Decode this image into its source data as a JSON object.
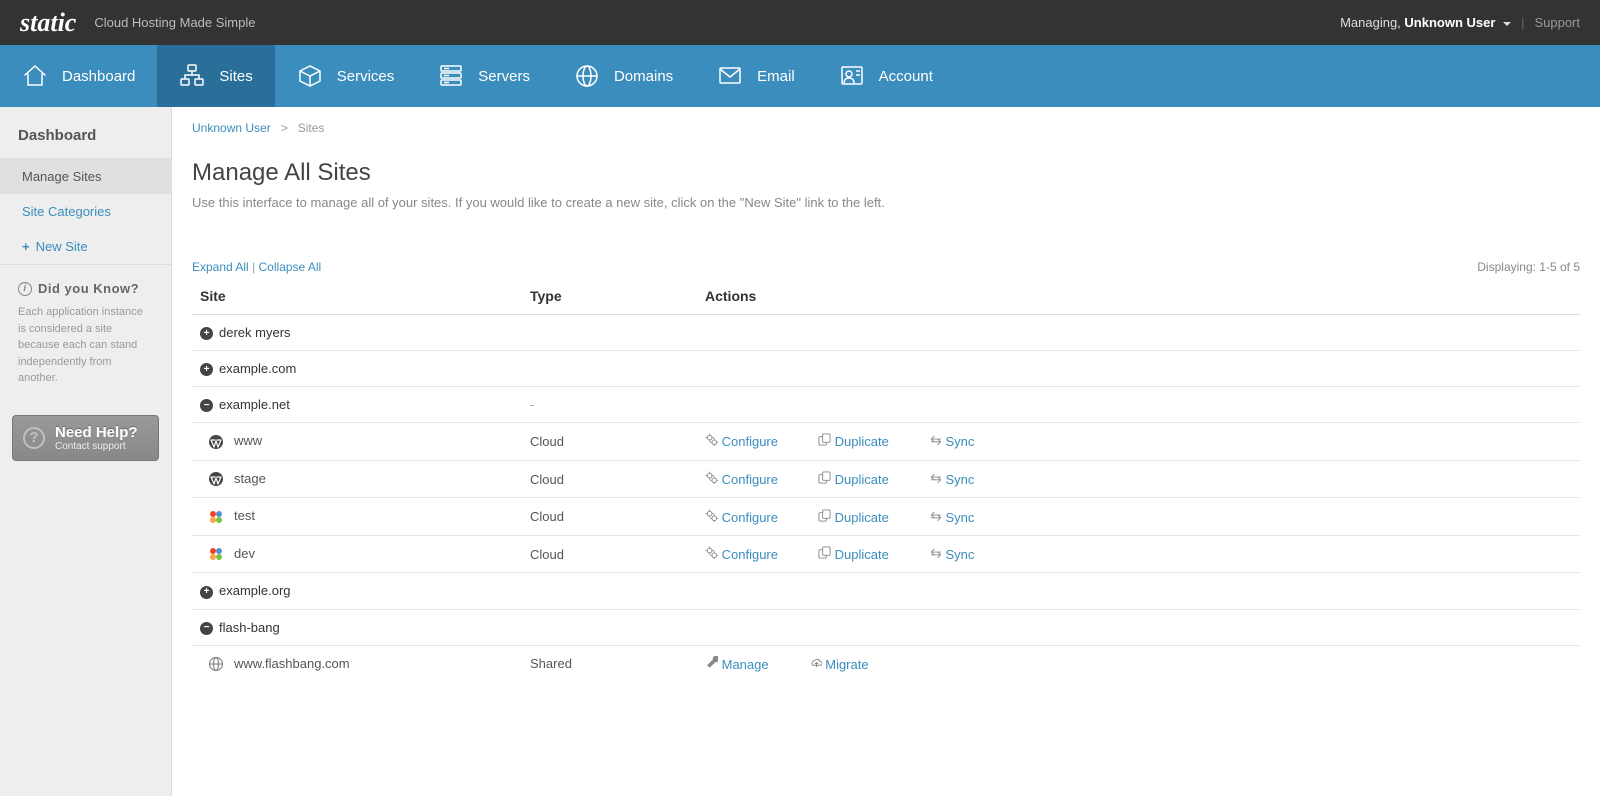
{
  "header": {
    "logo": "static",
    "tagline": "Cloud Hosting Made Simple",
    "managing_prefix": "Managing,",
    "managing_user": "Unknown User",
    "support": "Support"
  },
  "nav": {
    "dashboard": "Dashboard",
    "sites": "Sites",
    "services": "Services",
    "servers": "Servers",
    "domains": "Domains",
    "email": "Email",
    "account": "Account"
  },
  "sidebar": {
    "heading": "Dashboard",
    "manage_sites": "Manage Sites",
    "site_categories": "Site Categories",
    "new_site": "New Site",
    "dyk_title": "Did you Know?",
    "dyk_text": "Each application instance is considered a site because each can stand independently from another.",
    "help_title": "Need Help?",
    "help_sub": "Contact support"
  },
  "breadcrumb": {
    "user": "Unknown User",
    "sep": ">",
    "current": "Sites"
  },
  "page": {
    "title": "Manage All Sites",
    "desc": "Use this interface to manage all of your sites. If you would like to create a new site, click on the \"New Site\" link to the left.",
    "expand_all": "Expand All",
    "collapse_all": "Collapse All",
    "displaying": "Displaying: 1-5 of 5"
  },
  "table": {
    "headers": {
      "site": "Site",
      "type": "Type",
      "actions": "Actions"
    },
    "actions": {
      "configure": "Configure",
      "duplicate": "Duplicate",
      "sync": "Sync",
      "manage": "Manage",
      "migrate": "Migrate"
    },
    "groups": [
      {
        "name": "derek myers",
        "expanded": false,
        "children": []
      },
      {
        "name": "example.com",
        "expanded": false,
        "children": []
      },
      {
        "name": "example.net",
        "expanded": true,
        "type_dash": "-",
        "children": [
          {
            "name": "www",
            "type": "Cloud",
            "platform": "wordpress",
            "action_set": "cloud"
          },
          {
            "name": "stage",
            "type": "Cloud",
            "platform": "wordpress",
            "action_set": "cloud"
          },
          {
            "name": "test",
            "type": "Cloud",
            "platform": "joomla",
            "action_set": "cloud"
          },
          {
            "name": "dev",
            "type": "Cloud",
            "platform": "joomla",
            "action_set": "cloud"
          }
        ]
      },
      {
        "name": "example.org",
        "expanded": false,
        "children": []
      },
      {
        "name": "flash-bang",
        "expanded": true,
        "children": [
          {
            "name": "www.flashbang.com",
            "type": "Shared",
            "platform": "globe",
            "action_set": "shared"
          }
        ]
      }
    ]
  }
}
